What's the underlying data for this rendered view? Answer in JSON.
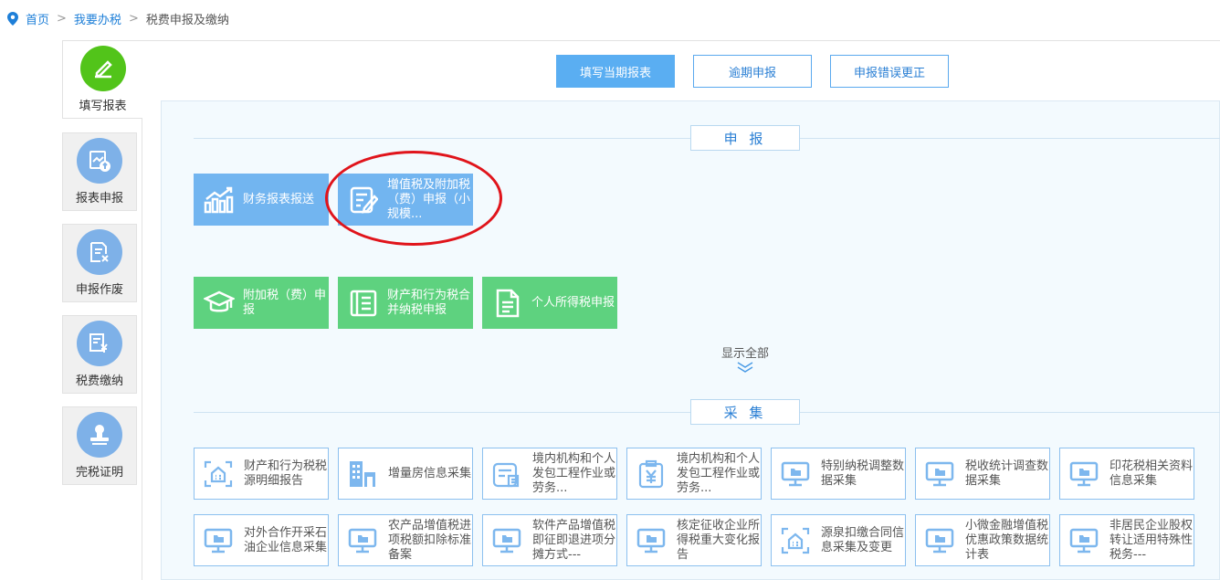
{
  "breadcrumb": {
    "items": [
      "首页",
      "我要办税",
      "税费申报及缴纳"
    ],
    "sep": ">"
  },
  "sidebar": {
    "items": [
      {
        "label": "填写报表",
        "active": true
      },
      {
        "label": "报表申报"
      },
      {
        "label": "申报作废"
      },
      {
        "label": "税费缴纳"
      },
      {
        "label": "完税证明"
      }
    ]
  },
  "tabs": [
    {
      "label": "填写当期报表",
      "active": true
    },
    {
      "label": "逾期申报"
    },
    {
      "label": "申报错误更正"
    }
  ],
  "declare": {
    "title": "申 报",
    "tiles": [
      {
        "label": "财务报表报送",
        "icon": "chart-growth-icon",
        "color": "#72b5f0"
      },
      {
        "label": "增值税及附加税（费）申报（小规模...",
        "icon": "edit-document-icon",
        "color": "#72b5f0",
        "highlighted": true
      },
      {
        "label": "附加税（费）申报",
        "icon": "graduation-cap-icon",
        "color": "#5ed27f"
      },
      {
        "label": "财产和行为税合并纳税申报",
        "icon": "ledger-icon",
        "color": "#5ed27f"
      },
      {
        "label": "个人所得税申报",
        "icon": "document-icon",
        "color": "#5ed27f"
      }
    ],
    "show_all": "显示全部"
  },
  "collect": {
    "title": "采 集",
    "tiles": [
      {
        "label": "财产和行为税税源明细报告",
        "icon": "house-scan-icon"
      },
      {
        "label": "增量房信息采集",
        "icon": "building-icon"
      },
      {
        "label": "境内机构和个人发包工程作业或劳务...",
        "icon": "form-icon"
      },
      {
        "label": "境内机构和个人发包工程作业或劳务...",
        "icon": "yuan-clipboard-icon"
      },
      {
        "label": "特别纳税调整数据采集",
        "icon": "monitor-folder-icon"
      },
      {
        "label": "税收统计调查数据采集",
        "icon": "monitor-folder-icon"
      },
      {
        "label": "印花税相关资料信息采集",
        "icon": "monitor-folder-icon"
      },
      {
        "label": "对外合作开采石油企业信息采集",
        "icon": "monitor-folder-icon"
      },
      {
        "label": "农产品增值税进项税额扣除标准备案",
        "icon": "monitor-folder-icon"
      },
      {
        "label": "软件产品增值税即征即退进项分摊方式---",
        "icon": "monitor-folder-icon"
      },
      {
        "label": "核定征收企业所得税重大变化报告",
        "icon": "monitor-folder-icon"
      },
      {
        "label": "源泉扣缴合同信息采集及变更",
        "icon": "house-scan-icon"
      },
      {
        "label": "小微金融增值税优惠政策数据统计表",
        "icon": "monitor-folder-icon"
      },
      {
        "label": "非居民企业股权转让适用特殊性税务---",
        "icon": "monitor-folder-icon"
      }
    ]
  }
}
